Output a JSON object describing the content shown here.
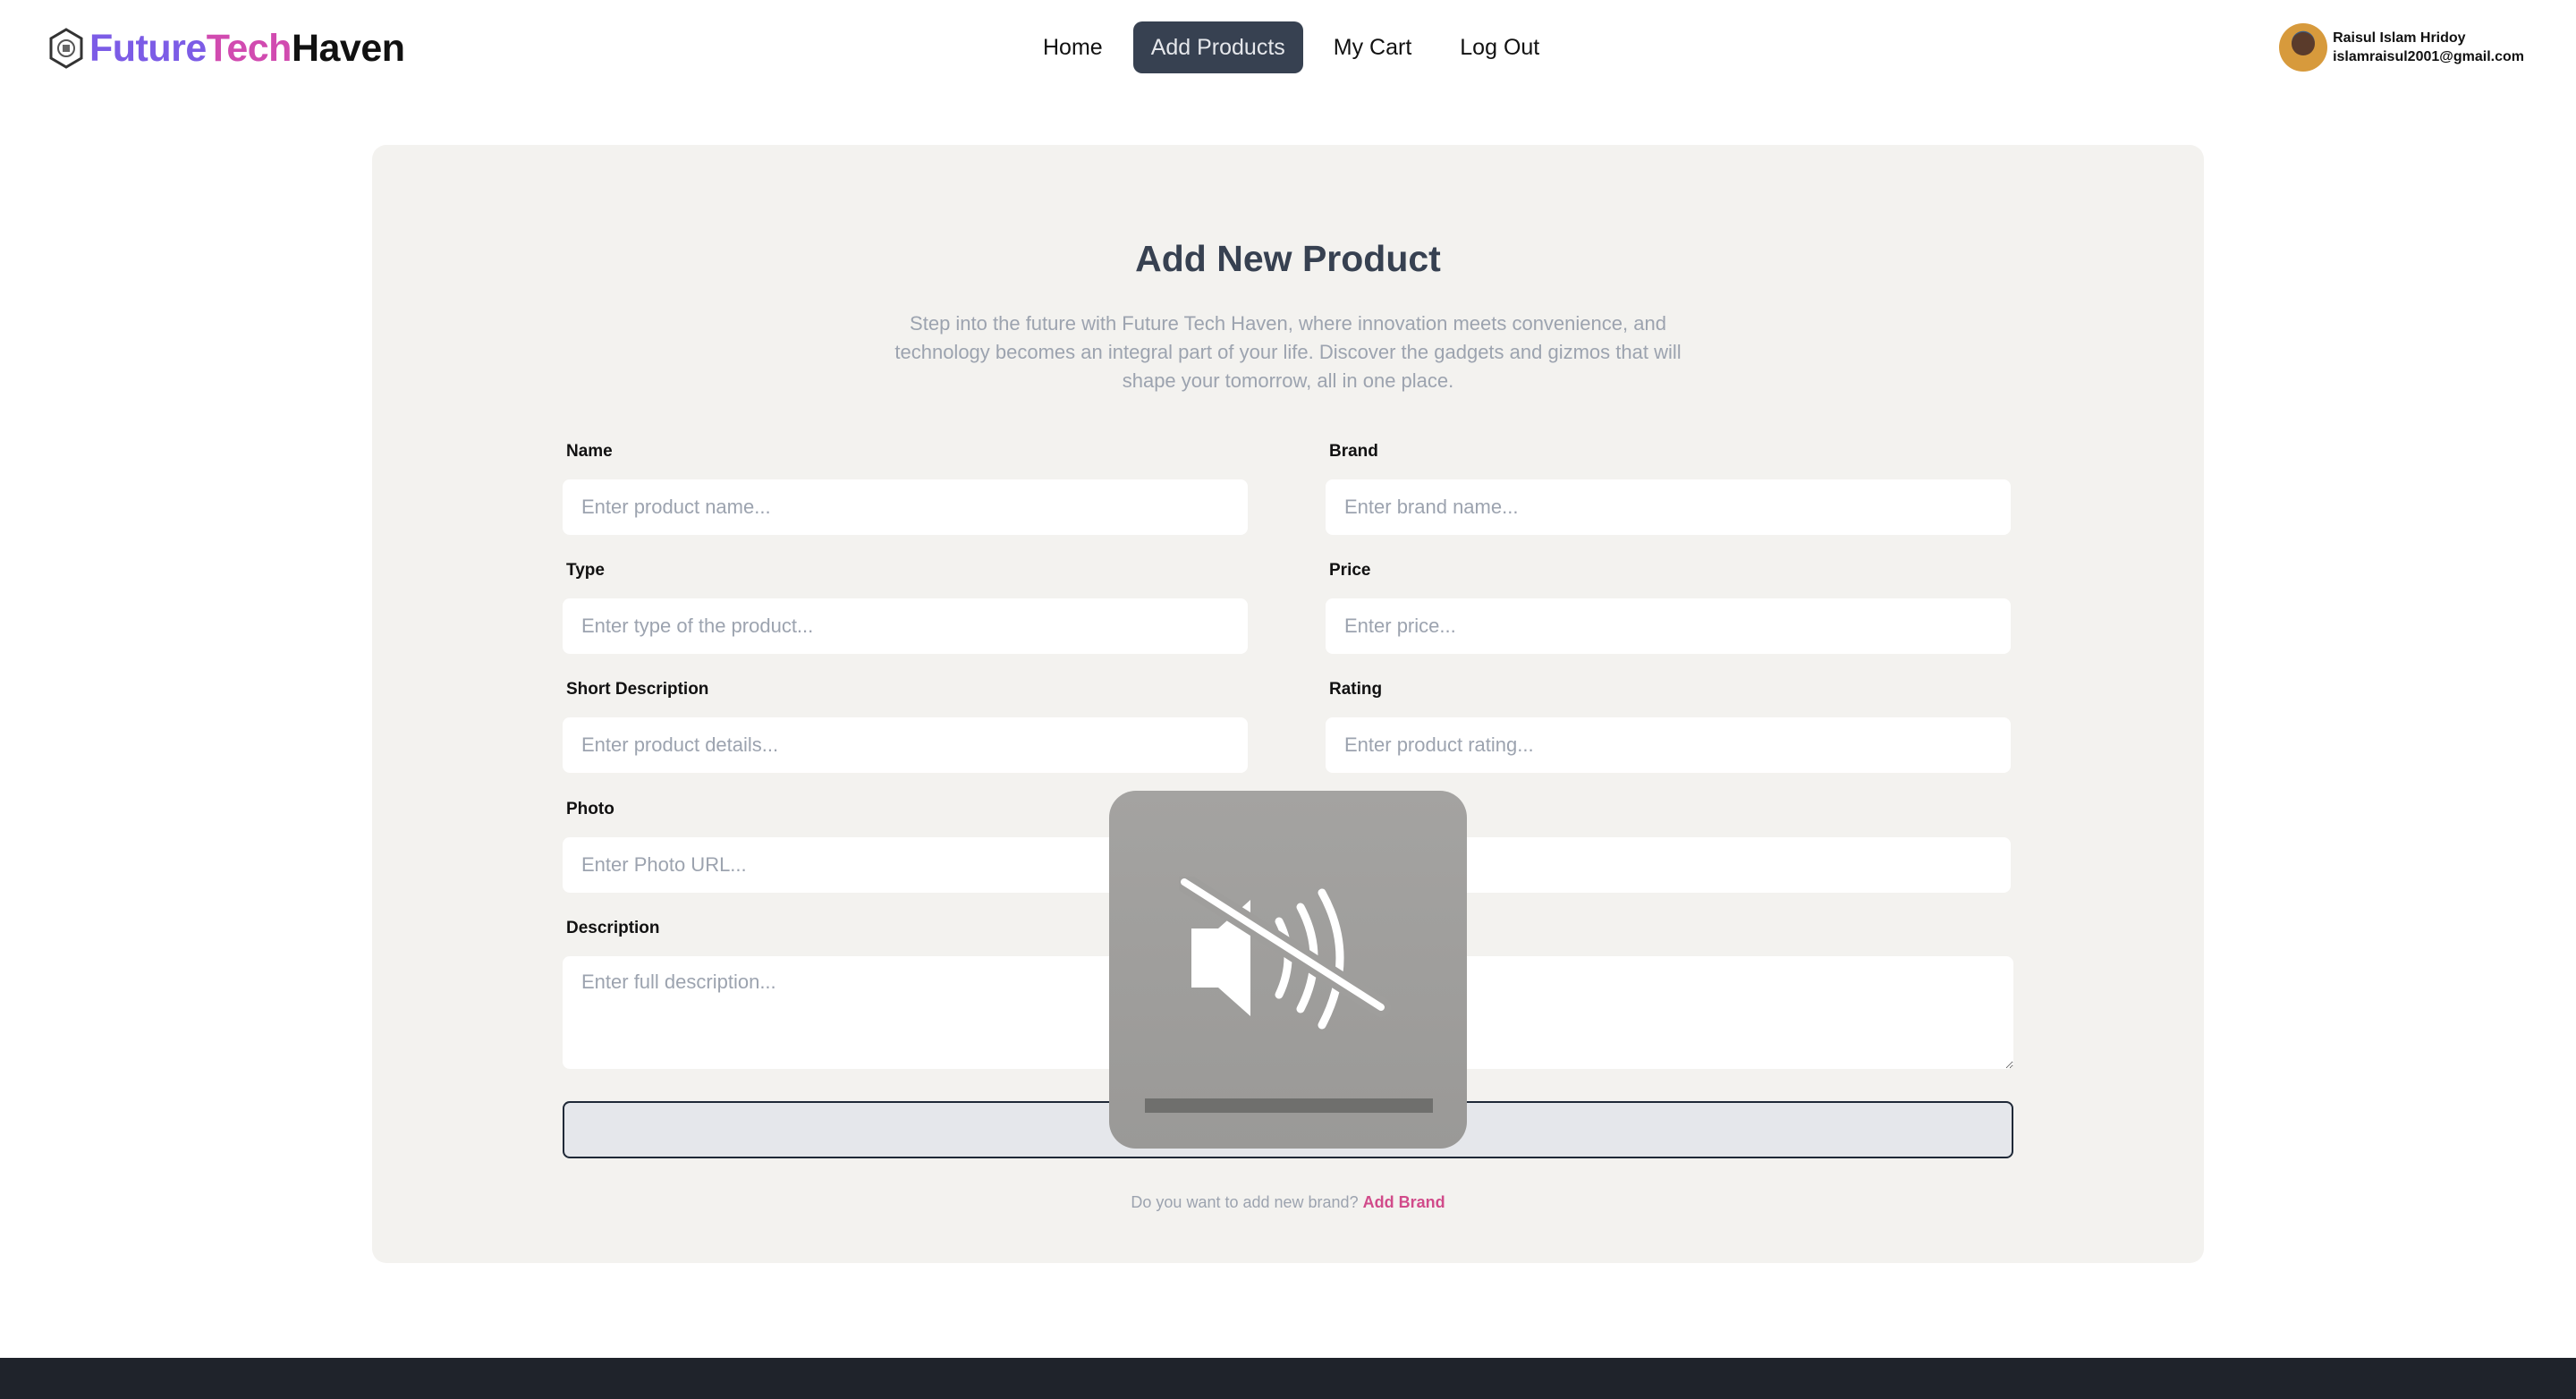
{
  "brand": {
    "part1": "Future",
    "part2": "Tech",
    "part3": "Haven"
  },
  "nav": {
    "home": "Home",
    "add_products": "Add Products",
    "my_cart": "My Cart",
    "log_out": "Log Out"
  },
  "user": {
    "name": "Raisul Islam Hridoy",
    "email": "islamraisul2001@gmail.com"
  },
  "form": {
    "title": "Add New Product",
    "subtitle": "Step into the future with Future Tech Haven, where innovation meets convenience, and technology becomes an integral part of your life. Discover the gadgets and gizmos that will shape your tomorrow, all in one place.",
    "fields": {
      "name": {
        "label": "Name",
        "placeholder": "Enter product name..."
      },
      "brand": {
        "label": "Brand",
        "placeholder": "Enter brand name..."
      },
      "type": {
        "label": "Type",
        "placeholder": "Enter type of the product..."
      },
      "price": {
        "label": "Price",
        "placeholder": "Enter price..."
      },
      "short_description": {
        "label": "Short Description",
        "placeholder": "Enter product details..."
      },
      "rating": {
        "label": "Rating",
        "placeholder": "Enter product rating..."
      },
      "photo": {
        "label": "Photo",
        "placeholder": "Enter Photo URL..."
      },
      "description": {
        "label": "Description",
        "placeholder": "Enter full description..."
      }
    },
    "footer_question": "Do you want to add new brand?",
    "footer_link": "Add Brand"
  },
  "overlay": {
    "icon": "speaker-muted-icon",
    "volume_level": 0
  },
  "colors": {
    "accent_purple": "#7c5ce6",
    "accent_pink": "#d14bb0",
    "nav_active_bg": "#374151",
    "link_pink": "#d14b8a"
  }
}
